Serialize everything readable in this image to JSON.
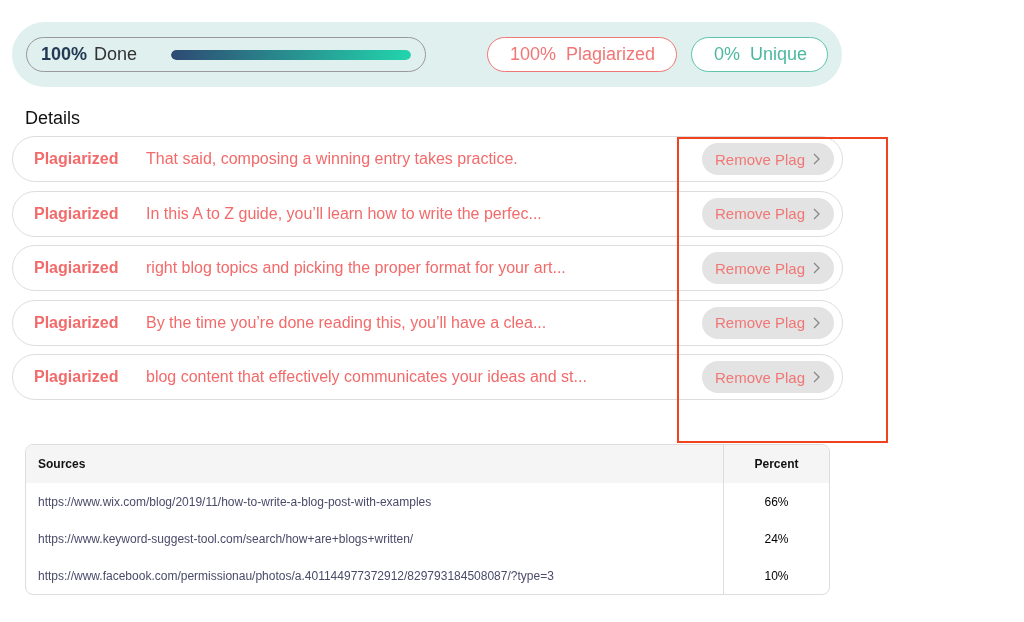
{
  "summary": {
    "done": {
      "percent": "100%",
      "label": "Done",
      "level": 1
    },
    "plagiarized": {
      "percent": "100%",
      "label": "Plagiarized"
    },
    "unique": {
      "percent": "0%",
      "label": "Unique"
    }
  },
  "details": {
    "title": "Details",
    "items": [
      {
        "status": "Plagiarized",
        "text": "That said, composing a winning entry takes practice.",
        "button": "Remove Plag"
      },
      {
        "status": "Plagiarized",
        "text": "In this A to Z guide, you’ll learn how to write the perfec...",
        "button": "Remove Plag"
      },
      {
        "status": "Plagiarized",
        "text": "right blog topics and picking the proper format for your art...",
        "button": "Remove Plag"
      },
      {
        "status": "Plagiarized",
        "text": "By the time you’re done reading this, you’ll have a clea...",
        "button": "Remove Plag"
      },
      {
        "status": "Plagiarized",
        "text": "blog content that effectively communicates your ideas and st...",
        "button": "Remove Plag"
      }
    ]
  },
  "sources": {
    "columns": [
      "Sources",
      "Percent"
    ],
    "rows": [
      {
        "url": "https://www.wix.com/blog/2019/11/how-to-write-a-blog-post-with-examples",
        "percent": "66%"
      },
      {
        "url": "https://www.keyword-suggest-tool.com/search/how+are+blogs+written/",
        "percent": "24%"
      },
      {
        "url": "https://www.facebook.com/permissionau/photos/a.401144977372912/829793184508087/?type=3",
        "percent": "10%"
      }
    ]
  }
}
